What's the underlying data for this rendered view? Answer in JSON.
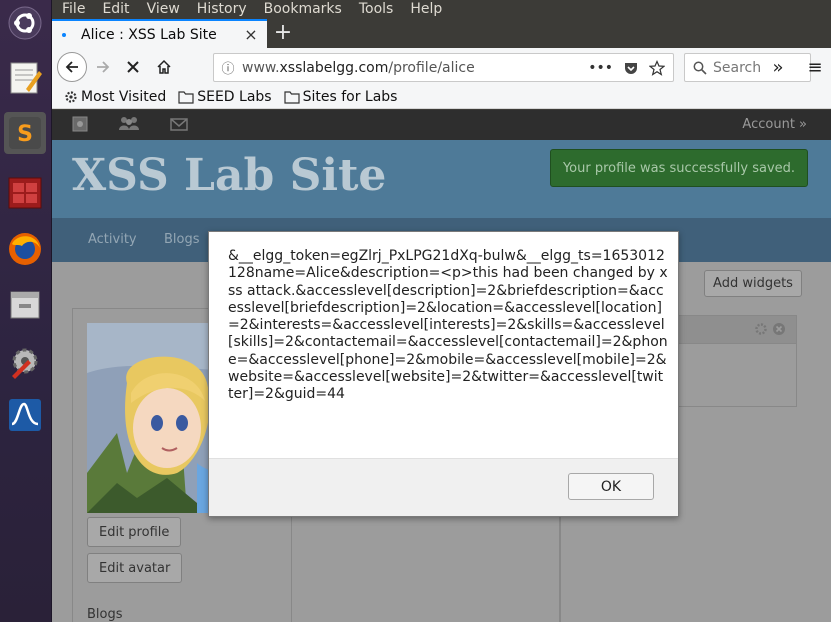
{
  "menubar": {
    "items": [
      {
        "label": "File"
      },
      {
        "label": "Edit"
      },
      {
        "label": "View"
      },
      {
        "label": "History"
      },
      {
        "label": "Bookmarks"
      },
      {
        "label": "Tools"
      },
      {
        "label": "Help"
      }
    ]
  },
  "launcher": {
    "icons": [
      "ubuntu-dash-icon",
      "text-editor-icon",
      "sublime-text-icon",
      "terminal-tiles-icon",
      "firefox-icon",
      "file-manager-icon",
      "system-settings-icon",
      "wireshark-icon"
    ]
  },
  "tab": {
    "title": "Alice : XSS Lab Site",
    "close": "×",
    "new_tab": "+"
  },
  "navbar": {
    "url_prefix": "www.",
    "url_domain": "xsslabelgg.com",
    "url_path": "/profile/alice",
    "page_actions": "•••",
    "search_placeholder": "Search",
    "overflow": "»",
    "menu": "≡"
  },
  "bookmarks": {
    "items": [
      {
        "label": "Most Visited"
      },
      {
        "label": "SEED Labs"
      },
      {
        "label": "Sites for Labs"
      }
    ]
  },
  "site": {
    "account_label": "Account »",
    "title": "XSS Lab Site",
    "saved_message": "Your profile was successfully saved.",
    "nav": [
      {
        "label": "Activity"
      },
      {
        "label": "Blogs"
      }
    ],
    "add_widgets": "Add widgets",
    "edit_profile": "Edit profile",
    "edit_avatar": "Edit avatar",
    "blogs_label": "Blogs"
  },
  "dialog": {
    "message": "&__elgg_token=egZlrj_PxLPG21dXq-bulw&__elgg_ts=1653012128name=Alice&description=<p>this had been changed by xss attack.&accesslevel[description]=2&briefdescription=&accesslevel[briefdescription]=2&location=&accesslevel[location]=2&interests=&accesslevel[interests]=2&skills=&accesslevel[skills]=2&contactemail=&accesslevel[contactemail]=2&phone=&accesslevel[phone]=2&mobile=&accesslevel[mobile]=2&website=&accesslevel[website]=2&twitter=&accesslevel[twitter]=2&guid=44",
    "ok_label": "OK"
  }
}
